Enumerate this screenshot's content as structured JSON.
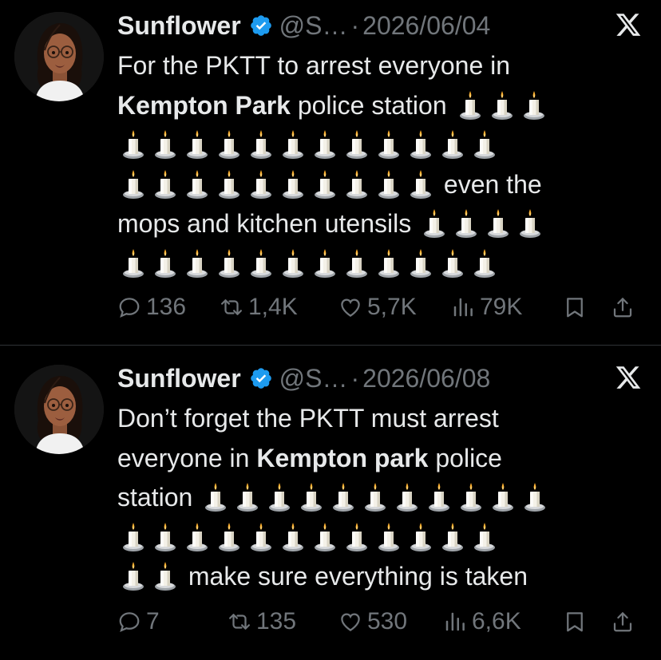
{
  "tweets": [
    {
      "name": "Sunflower",
      "handle": "@S…",
      "separator": "·",
      "date": "2026/06/04",
      "text_parts": {
        "p1": "For the PKTT to arrest everyone in",
        "bold1": "Kempton Park",
        "p2": " police station",
        "p3": "even the",
        "p4": "mops and kitchen utensils"
      },
      "candle_emoji": "🕯️",
      "stats": {
        "replies": "136",
        "retweets": "1,4K",
        "likes": "5,7K",
        "views": "79K"
      }
    },
    {
      "name": "Sunflower",
      "handle": "@S…",
      "separator": "·",
      "date": "2026/06/08",
      "text_parts": {
        "p1": "Don’t forget the PKTT must arrest",
        "p2": "everyone in ",
        "bold1": "Kempton park",
        "p3": " police",
        "p4": "station",
        "p5": "make sure everything is taken"
      },
      "candle_emoji": "🕯️",
      "stats": {
        "replies": "7",
        "retweets": "135",
        "likes": "530",
        "views": "6,6K"
      }
    }
  ],
  "icons": {
    "verified": "verified-badge-icon",
    "x_logo": "x-logo-icon",
    "reply": "reply-icon",
    "retweet": "retweet-icon",
    "like": "like-icon",
    "views": "views-icon",
    "bookmark": "bookmark-icon",
    "share": "share-icon",
    "candle": "candle-icon"
  },
  "colors": {
    "background": "#000000",
    "text": "#e7e9ea",
    "muted": "#71767b",
    "verified_blue": "#1d9bf0",
    "divider": "#2f3336"
  }
}
